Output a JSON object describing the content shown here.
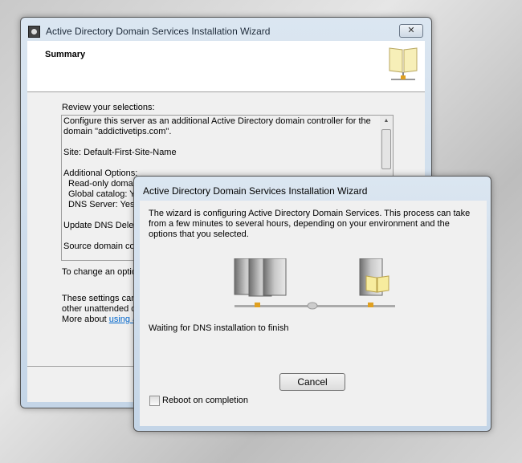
{
  "back_window": {
    "title": "Active Directory Domain Services Installation Wizard",
    "close_label": "✕",
    "header_title": "Summary",
    "review_label": "Review your selections:",
    "summary_lines": [
      "Configure this server as an additional Active Directory domain controller for the",
      "domain \"addictivetips.com\".",
      "",
      "Site: Default-First-Site-Name",
      "",
      "Additional Options:",
      "  Read-only domain",
      "  Global catalog: Ye",
      "  DNS Server: Yes",
      "",
      "Update DNS Deleg",
      "",
      "Source domain con"
    ],
    "change_text": "To change an optio",
    "settings_line1": "These settings can",
    "settings_line2": "other unattended o",
    "more_about": "More about ",
    "link_text": "using a"
  },
  "progress_dialog": {
    "title": "Active Directory Domain Services Installation Wizard",
    "description": "The wizard is configuring Active Directory Domain Services. This process can take from a few minutes to several hours, depending on your environment and the options that you selected.",
    "status": "Waiting for DNS installation to finish",
    "cancel_label": "Cancel",
    "reboot_label": "Reboot on completion",
    "reboot_checked": false
  }
}
